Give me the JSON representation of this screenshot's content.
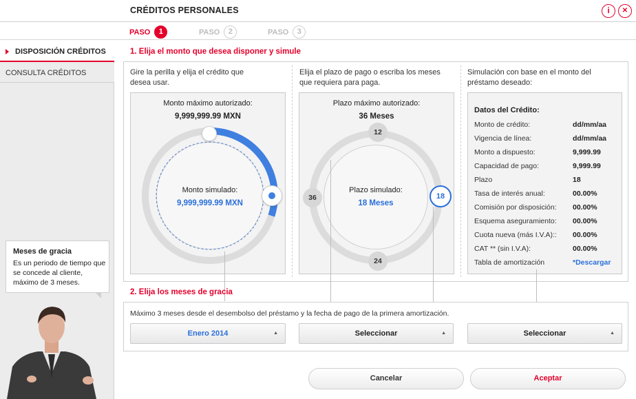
{
  "header": {
    "title": "CRÉDITOS PERSONALES",
    "info_icon": "i",
    "close_icon": "✕"
  },
  "steps": [
    {
      "label": "PASO",
      "number": "1"
    },
    {
      "label": "PASO",
      "number": "2"
    },
    {
      "label": "PASO",
      "number": "3"
    }
  ],
  "sidebar": {
    "items": [
      {
        "label": "DISPOSICIÓN CRÉDITOS"
      },
      {
        "label": "CONSULTA CRÉDITOS"
      }
    ]
  },
  "tooltip": {
    "title": "Meses de gracia",
    "text": "Es un periodo de tiempo que se concede al cliente, máximo de 3 meses."
  },
  "section1": {
    "title": "1. Elija el monto que desea disponer y simule"
  },
  "monto": {
    "instruction": "Gire la perilla y elija el crédito que desea usar.",
    "max_label": "Monto máximo autorizado:",
    "max_value": "9,999,999.99 MXN",
    "sim_label": "Monto simulado:",
    "sim_value": "9,999,999.99 MXN",
    "progress": 0.3
  },
  "plazo": {
    "instruction": "Elija el plazo de pago o escriba los meses que requiera para paga.",
    "max_label": "Plazo máximo autorizado:",
    "max_value": "36 Meses",
    "sim_label": "Plazo simulado:",
    "sim_value": "18 Meses",
    "marks": {
      "top": "12",
      "left": "36",
      "bottom": "24",
      "right": "18"
    }
  },
  "simulacion": {
    "instruction": "Simulación con base en el monto del préstamo deseado:",
    "title": "Datos del Crédito:",
    "rows": [
      {
        "label": "Monto de crédito:",
        "value": "dd/mm/aa"
      },
      {
        "label": "Vigencia de línea:",
        "value": "dd/mm/aa"
      },
      {
        "label": "Monto a dispuesto:",
        "value": "9,999.99"
      },
      {
        "label": "Capacidad de pago:",
        "value": "9,999.99"
      },
      {
        "label": "Plazo",
        "value": "18"
      },
      {
        "label": "Tasa de interés anual:",
        "value": "00.00%"
      },
      {
        "label": "Comisión por disposición:",
        "value": "00.00%"
      },
      {
        "label": "Esquema aseguramiento:",
        "value": "00.00%"
      },
      {
        "label": "Cuota nueva (más I.V.A)::",
        "value": "00.00%"
      },
      {
        "label": "CAT ** (sin I.V.A):",
        "value": "00.00%"
      },
      {
        "label": "Tabla de amortización",
        "value": "*Descargar"
      }
    ]
  },
  "section2": {
    "title": "2. Elija los meses de gracia",
    "description": "Máximo 3 meses desde el desembolso del préstamo y la fecha de pago de la primera amortización.",
    "selects": [
      {
        "value": "Enero 2014"
      },
      {
        "value": "Seleccionar"
      },
      {
        "value": "Seleccionar"
      }
    ]
  },
  "buttons": {
    "cancel": "Cancelar",
    "accept": "Aceptar"
  },
  "colors": {
    "accent": "#e4002b",
    "blue": "#2a6fdb"
  }
}
